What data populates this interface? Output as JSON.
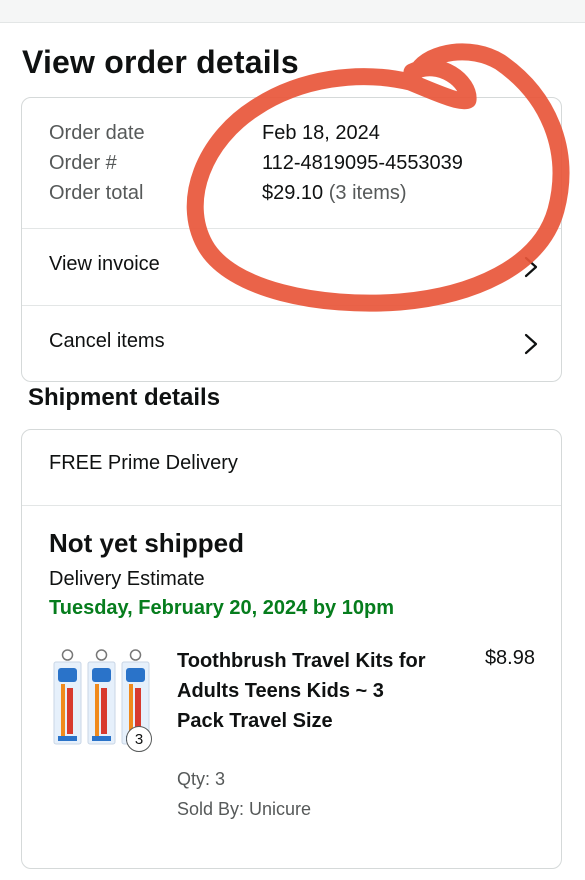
{
  "page": {
    "title": "View order details"
  },
  "summary": {
    "order_date_label": "Order date",
    "order_date": "Feb 18, 2024",
    "order_number_label": "Order #",
    "order_number": "112-4819095-4553039",
    "order_total_label": "Order total",
    "order_total": "$29.10",
    "item_count": "(3 items)",
    "view_invoice": "View invoice",
    "cancel_items": "Cancel items"
  },
  "shipment": {
    "section_title": "Shipment details",
    "delivery_method": "FREE Prime Delivery",
    "status": "Not yet shipped",
    "estimate_label": "Delivery Estimate",
    "estimate_date": "Tuesday, February 20, 2024 by 10pm",
    "estimate_color": "#067d1d",
    "item": {
      "title": "Toothbrush Travel Kits for Adults Teens Kids ~ 3 Pack Travel Size",
      "price": "$8.98",
      "qty": "Qty: 3",
      "sold_by": "Sold By: Unicure",
      "badge": "3"
    }
  },
  "annotation": {
    "color": "#e8563a",
    "description_icon": "hand-drawn-circle"
  }
}
